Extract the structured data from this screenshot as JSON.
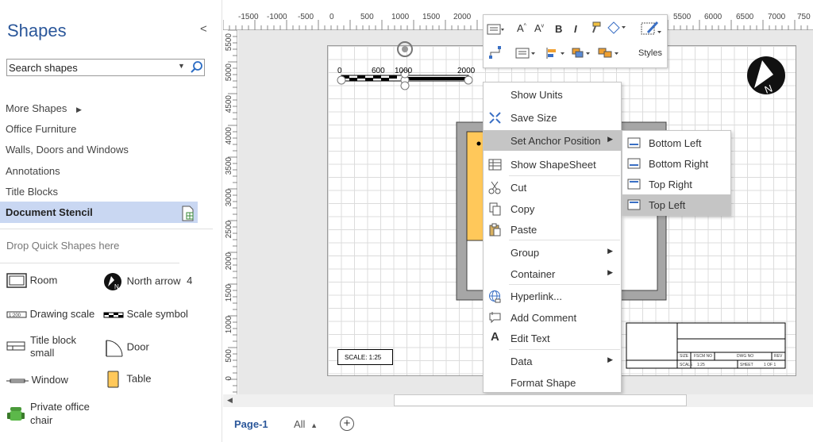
{
  "pane": {
    "title": "Shapes",
    "collapse": "<",
    "search_placeholder": "Search shapes",
    "categories": [
      "More Shapes",
      "Office Furniture",
      "Walls, Doors and Windows",
      "Annotations",
      "Title Blocks",
      "Document Stencil"
    ],
    "more_arrow": "▶",
    "quick_shapes": "Drop Quick Shapes here",
    "shapes": [
      "Room",
      "North arrow",
      "4",
      "Drawing scale",
      "Scale symbol",
      "Title block small",
      "Door",
      "Window",
      "Table",
      "Private office chair"
    ]
  },
  "ruler": {
    "top": [
      "-1500",
      "-1000",
      "-500",
      "0",
      "500",
      "1000",
      "1500",
      "2000",
      "5500",
      "6000",
      "6500",
      "7000",
      "750"
    ],
    "left": [
      "5500",
      "5000",
      "4500",
      "4000",
      "3500",
      "3000",
      "2500",
      "2000",
      "1500",
      "1000",
      "500",
      "0"
    ]
  },
  "drawing": {
    "scale_ticks": [
      "0",
      "600",
      "1000",
      "2000"
    ],
    "scale_label": "SCALE: 1:25",
    "title_block": {
      "size": "SIZE",
      "fscm": "FSCM NO",
      "dwg": "DWG NO",
      "rev": "REV",
      "scale": "SCALE",
      "scale_val": "1:25",
      "sheet": "SHEET",
      "sheet_val": "1 OF 1"
    }
  },
  "toolbar": {
    "bold": "B",
    "italic": "I",
    "styles": "Styles"
  },
  "context_menu": [
    {
      "label": "Show Units"
    },
    {
      "label": "Save Size"
    },
    {
      "label": "Set Anchor Position",
      "arrow": "▶"
    },
    {
      "label": "Show ShapeSheet"
    },
    {
      "label": "Cut"
    },
    {
      "label": "Copy"
    },
    {
      "label": "Paste"
    },
    {
      "label": "Group",
      "arrow": "▶"
    },
    {
      "label": "Container",
      "arrow": "▶"
    },
    {
      "label": "Hyperlink..."
    },
    {
      "label": "Add Comment"
    },
    {
      "label": "Edit Text"
    },
    {
      "label": "Data",
      "arrow": "▶"
    },
    {
      "label": "Format Shape"
    }
  ],
  "submenu": [
    "Bottom Left",
    "Bottom Right",
    "Top Right",
    "Top Left"
  ],
  "tabs": {
    "page1": "Page-1",
    "all": "All",
    "all_arrow": "▲",
    "add": "+"
  },
  "colors": {
    "accent": "#2b579a",
    "table_fill": "#ffc85a",
    "room_wall": "#a6a6a6",
    "highlight": "#c5c5c5"
  }
}
